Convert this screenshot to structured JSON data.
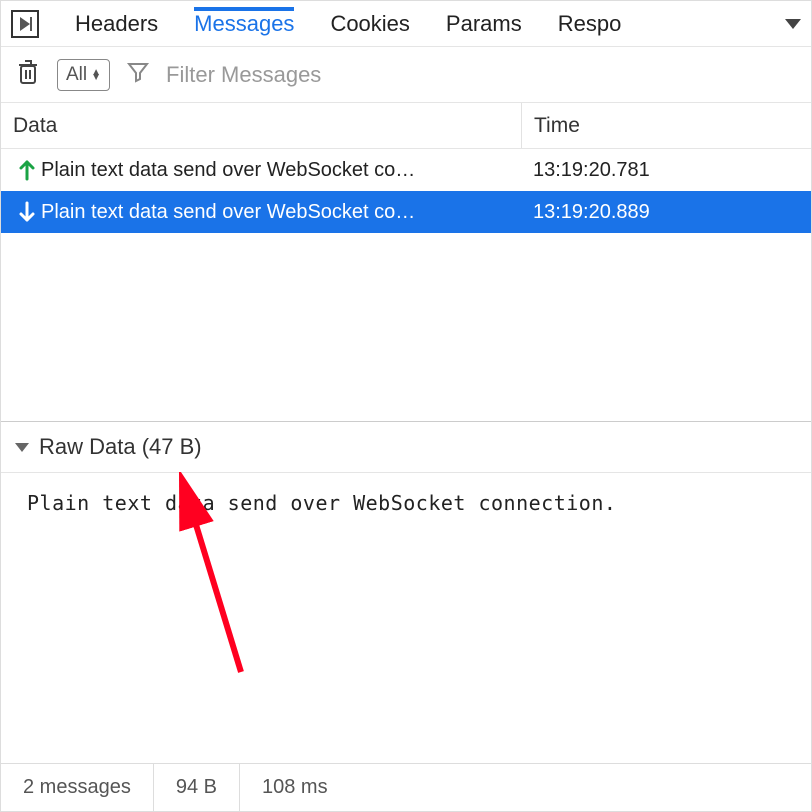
{
  "tabs": {
    "items": [
      "Headers",
      "Messages",
      "Cookies",
      "Params",
      "Respo"
    ],
    "activeIndex": 1
  },
  "toolbar": {
    "filterSelect": "All",
    "filterPlaceholder": "Filter Messages"
  },
  "columns": {
    "data": "Data",
    "time": "Time"
  },
  "messages": [
    {
      "direction": "up",
      "text": "Plain text data send over WebSocket co…",
      "time": "13:19:20.781",
      "selected": false
    },
    {
      "direction": "down",
      "text": "Plain text data send over WebSocket co…",
      "time": "13:19:20.889",
      "selected": true
    }
  ],
  "rawData": {
    "header": "Raw Data (47 B)",
    "body": "Plain text data send over WebSocket connection."
  },
  "footer": {
    "count": "2 messages",
    "size": "94 B",
    "duration": "108 ms"
  }
}
